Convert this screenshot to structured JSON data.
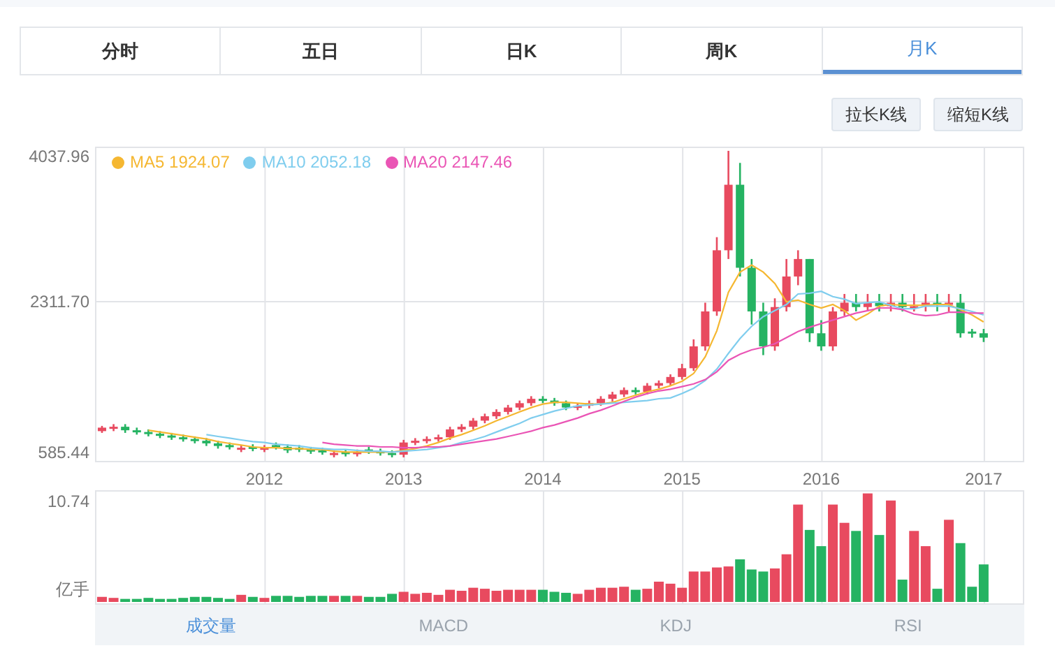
{
  "period_tabs": [
    {
      "label": "分时",
      "selected": false
    },
    {
      "label": "五日",
      "selected": false
    },
    {
      "label": "日K",
      "selected": false
    },
    {
      "label": "周K",
      "selected": false
    },
    {
      "label": "月K",
      "selected": true
    }
  ],
  "zoom_buttons": [
    "拉长K线",
    "缩短K线"
  ],
  "price_chart": {
    "legend_values": [
      "1924.07",
      "2052.18",
      "2147.46"
    ],
    "chart_data": {
      "type": "candlestick",
      "categories": [
        null,
        null,
        null,
        null,
        null,
        null,
        null,
        null,
        null,
        null,
        null,
        null,
        null,
        null,
        "2012",
        null,
        null,
        null,
        null,
        null,
        null,
        null,
        null,
        null,
        null,
        null,
        "2013",
        null,
        null,
        null,
        null,
        null,
        null,
        null,
        null,
        null,
        null,
        null,
        "2014",
        null,
        null,
        null,
        null,
        null,
        null,
        null,
        null,
        null,
        null,
        null,
        "2015",
        null,
        null,
        null,
        null,
        null,
        null,
        null,
        null,
        null,
        null,
        null,
        "2016",
        null,
        null,
        null,
        null,
        null,
        null,
        null,
        null,
        null,
        null,
        null,
        null,
        null,
        "2017"
      ],
      "ohlc": [
        [
          830,
          890,
          810,
          870
        ],
        [
          860,
          910,
          830,
          880
        ],
        [
          880,
          910,
          810,
          840
        ],
        [
          840,
          870,
          790,
          820
        ],
        [
          820,
          850,
          770,
          800
        ],
        [
          800,
          830,
          750,
          780
        ],
        [
          780,
          810,
          730,
          760
        ],
        [
          760,
          790,
          710,
          740
        ],
        [
          740,
          770,
          690,
          720
        ],
        [
          720,
          750,
          660,
          690
        ],
        [
          690,
          720,
          630,
          660
        ],
        [
          670,
          700,
          620,
          650
        ],
        [
          620,
          670,
          590,
          640
        ],
        [
          650,
          680,
          600,
          630
        ],
        [
          620,
          670,
          590,
          640
        ],
        [
          670,
          700,
          620,
          650
        ],
        [
          650,
          680,
          580,
          610
        ],
        [
          640,
          670,
          590,
          620
        ],
        [
          620,
          650,
          570,
          600
        ],
        [
          610,
          640,
          560,
          590
        ],
        [
          560,
          610,
          530,
          580
        ],
        [
          590,
          620,
          540,
          570
        ],
        [
          570,
          620,
          540,
          590
        ],
        [
          620,
          650,
          570,
          600
        ],
        [
          600,
          630,
          550,
          580
        ],
        [
          580,
          610,
          530,
          560
        ],
        [
          560,
          730,
          530,
          700
        ],
        [
          700,
          750,
          670,
          720
        ],
        [
          720,
          770,
          690,
          740
        ],
        [
          740,
          790,
          710,
          760
        ],
        [
          760,
          880,
          730,
          850
        ],
        [
          850,
          910,
          820,
          880
        ],
        [
          880,
          980,
          850,
          950
        ],
        [
          950,
          1030,
          920,
          1000
        ],
        [
          1000,
          1080,
          970,
          1050
        ],
        [
          1050,
          1130,
          1020,
          1100
        ],
        [
          1100,
          1180,
          1070,
          1150
        ],
        [
          1150,
          1230,
          1120,
          1200
        ],
        [
          1200,
          1230,
          1150,
          1180
        ],
        [
          1180,
          1210,
          1120,
          1150
        ],
        [
          1150,
          1180,
          1070,
          1100
        ],
        [
          1100,
          1150,
          1070,
          1120
        ],
        [
          1120,
          1180,
          1090,
          1150
        ],
        [
          1150,
          1230,
          1120,
          1200
        ],
        [
          1200,
          1280,
          1170,
          1250
        ],
        [
          1250,
          1330,
          1220,
          1300
        ],
        [
          1300,
          1330,
          1250,
          1280
        ],
        [
          1280,
          1380,
          1250,
          1350
        ],
        [
          1350,
          1410,
          1320,
          1380
        ],
        [
          1380,
          1480,
          1350,
          1450
        ],
        [
          1450,
          1600,
          1420,
          1550
        ],
        [
          1550,
          1880,
          1520,
          1800
        ],
        [
          1800,
          2300,
          1750,
          2200
        ],
        [
          2200,
          3050,
          2150,
          2900
        ],
        [
          2900,
          4037.96,
          2800,
          3650
        ],
        [
          3650,
          3900,
          2600,
          2700
        ],
        [
          2700,
          2800,
          2050,
          2200
        ],
        [
          2200,
          2300,
          1700,
          1800
        ],
        [
          1800,
          2350,
          1750,
          2250
        ],
        [
          2250,
          2800,
          2200,
          2600
        ],
        [
          2600,
          2900,
          2500,
          2800
        ],
        [
          2800,
          2800,
          1850,
          1950
        ],
        [
          1950,
          2100,
          1750,
          1800
        ],
        [
          1800,
          2250,
          1750,
          2200
        ],
        [
          2200,
          2400,
          2150,
          2300
        ],
        [
          2300,
          2400,
          2200,
          2250
        ],
        [
          2250,
          2400,
          2200,
          2300
        ],
        [
          2300,
          2400,
          2200,
          2260
        ],
        [
          2260,
          2400,
          2200,
          2300
        ],
        [
          2300,
          2400,
          2200,
          2250
        ],
        [
          2240,
          2400,
          2200,
          2260
        ],
        [
          2260,
          2400,
          2200,
          2300
        ],
        [
          2300,
          2400,
          2200,
          2280
        ],
        [
          2280,
          2400,
          2200,
          2300
        ],
        [
          2300,
          2400,
          1900,
          1950
        ],
        [
          1970,
          2000,
          1900,
          1950
        ],
        [
          1950,
          2000,
          1850,
          1900
        ]
      ],
      "ylim": [
        473.5,
        4086
      ],
      "grid": true,
      "legend": "upper left",
      "yticks": [
        {
          "value": 4037.96,
          "label": "4037.96"
        },
        {
          "value": 2311.7,
          "label": "2311.70"
        },
        {
          "value": 585.44,
          "label": "585.44"
        }
      ],
      "series": [
        {
          "name": "MA5",
          "type": "line",
          "color": "#f5b731",
          "values": [
            null,
            null,
            null,
            null,
            840,
            820,
            800,
            780,
            760,
            740,
            710,
            690,
            670,
            650,
            640,
            640,
            630,
            630,
            620,
            620,
            600,
            590,
            590,
            590,
            590,
            590,
            610,
            630,
            660,
            700,
            750,
            790,
            840,
            890,
            950,
            1000,
            1050,
            1100,
            1140,
            1160,
            1160,
            1150,
            1140,
            1140,
            1160,
            1200,
            1240,
            1280,
            1310,
            1350,
            1400,
            1490,
            1680,
            1980,
            2420,
            2650,
            2730,
            2650,
            2520,
            2310,
            2330,
            2280,
            2240,
            2280,
            2210,
            2100,
            2170,
            2260,
            2280,
            2270,
            2270,
            2270,
            2280,
            2280,
            2220,
            2160,
            2080
          ]
        },
        {
          "name": "MA10",
          "type": "line",
          "color": "#7fcdee",
          "values": [
            null,
            null,
            null,
            null,
            null,
            null,
            null,
            null,
            null,
            790,
            770,
            750,
            730,
            710,
            700,
            680,
            670,
            660,
            640,
            630,
            620,
            620,
            610,
            600,
            600,
            590,
            600,
            610,
            620,
            640,
            660,
            700,
            730,
            770,
            820,
            870,
            920,
            980,
            1020,
            1060,
            1090,
            1120,
            1130,
            1140,
            1150,
            1160,
            1170,
            1180,
            1200,
            1210,
            1260,
            1320,
            1410,
            1540,
            1720,
            1890,
            2030,
            2140,
            2210,
            2280,
            2400,
            2410,
            2430,
            2370,
            2340,
            2290,
            2300,
            2310,
            2270,
            2230,
            2230,
            2260,
            2260,
            2260,
            2230,
            2200,
            2160
          ]
        },
        {
          "name": "MA20",
          "type": "line",
          "color": "#ea55b5",
          "values": [
            null,
            null,
            null,
            null,
            null,
            null,
            null,
            null,
            null,
            null,
            null,
            null,
            null,
            null,
            null,
            null,
            null,
            null,
            null,
            700,
            680,
            670,
            660,
            660,
            650,
            650,
            640,
            640,
            650,
            650,
            660,
            680,
            700,
            720,
            740,
            770,
            800,
            830,
            870,
            900,
            940,
            980,
            1030,
            1070,
            1120,
            1170,
            1220,
            1260,
            1290,
            1310,
            1340,
            1370,
            1420,
            1510,
            1640,
            1710,
            1760,
            1790,
            1830,
            1900,
            1970,
            2020,
            2060,
            2100,
            2140,
            2180,
            2210,
            2240,
            2240,
            2220,
            2170,
            2150,
            2160,
            2190,
            2190,
            2180,
            2180
          ]
        }
      ]
    }
  },
  "volume_chart": {
    "y_labels": [
      "10.74",
      "亿手"
    ]
  },
  "indicator_tabs": [
    {
      "label": "成交量",
      "selected": true
    },
    {
      "label": "MACD",
      "selected": false
    },
    {
      "label": "KDJ",
      "selected": false
    },
    {
      "label": "RSI",
      "selected": false
    }
  ]
}
